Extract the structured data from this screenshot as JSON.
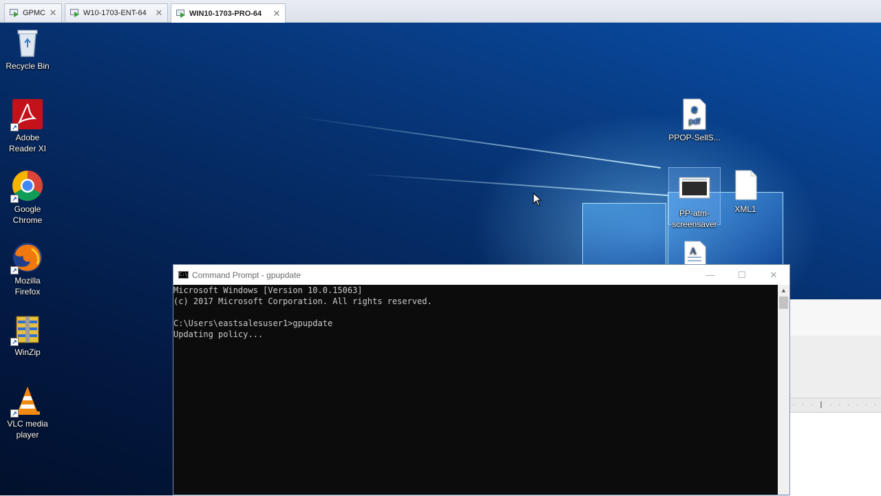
{
  "vm_tabs": [
    {
      "label": "GPMC",
      "active": false
    },
    {
      "label": "W10-1703-ENT-64",
      "active": false
    },
    {
      "label": "WIN10-1703-PRO-64",
      "active": true
    }
  ],
  "tab_close_glyph": "✕",
  "desktop_icons": {
    "recycle_bin": "Recycle Bin",
    "adobe_reader": "Adobe Reader XI",
    "chrome": "Google Chrome",
    "firefox": "Mozilla Firefox",
    "winzip": "WinZip",
    "vlc": "VLC media player",
    "ppop_pdf": "PPOP-SellS...",
    "pp_atm": "PP-atm-screensaver",
    "xml1": "XML1"
  },
  "cmd_window": {
    "title": "Command Prompt - gpupdate",
    "lines": [
      "Microsoft Windows [Version 10.0.15063]",
      "(c) 2017 Microsoft Corporation. All rights reserved.",
      "",
      "C:\\Users\\eastsalesuser1>gpupdate",
      "Updating policy..."
    ],
    "buttons": {
      "minimize": "—",
      "maximize": "☐",
      "close": "✕"
    },
    "scroll_up": "▲"
  },
  "colors": {
    "desktop_blue": "#0a4fa8",
    "console_bg": "#0c0c0c",
    "console_text": "#cccccc"
  },
  "bg_window_ruler": "· · · ┃ · · · · · · ⊥ · · · · ·"
}
